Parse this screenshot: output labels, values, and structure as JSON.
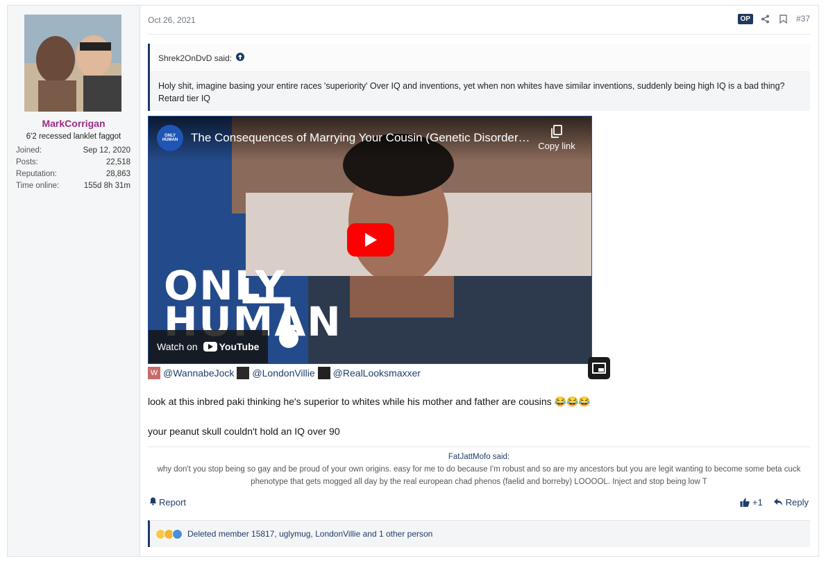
{
  "user": {
    "name": "MarkCorrigan",
    "title": "6'2 recessed lanklet faggot",
    "stats": [
      {
        "label": "Joined:",
        "value": "Sep 12, 2020"
      },
      {
        "label": "Posts:",
        "value": "22,518"
      },
      {
        "label": "Reputation:",
        "value": "28,863"
      },
      {
        "label": "Time online:",
        "value": "155d 8h 31m"
      }
    ]
  },
  "post": {
    "date": "Oct 26, 2021",
    "op_badge": "OP",
    "number": "#37",
    "quote": {
      "author": "Shrek2OnDvD said:",
      "text": "Holy shit, imagine basing your entire races 'superiority' Over IQ and inventions, yet when non whites have similar inventions, suddenly being high IQ is a bad thing? Retard tier IQ"
    },
    "video": {
      "channel_logo_text": "ONLY HUMAN",
      "title": "The Consequences of Marrying Your Cousin (Genetic Disorders Documentary)",
      "copy_link": "Copy link",
      "watch_on": "Watch on",
      "youtube": "YouTube",
      "overlay_text": "ONLY\nHUMAN"
    },
    "mentions": [
      {
        "name": "@WannabeJock",
        "avatar_letter": "W",
        "avatar_color": "#c96a6a"
      },
      {
        "name": "@LondonVillie",
        "avatar_letter": "",
        "avatar_color": "#2a2a2a"
      },
      {
        "name": "@RealLooksmaxxer",
        "avatar_letter": "",
        "avatar_color": "#222222"
      }
    ],
    "line1": "look at this inbred paki thinking he's superior to whites while his mother and father are cousins",
    "line2": "your peanut skull couldn't hold an IQ over 90",
    "signature": {
      "author": "FatJattMofo said:",
      "text": "why don't you stop being so gay and be proud of your own origins. easy for me to do because I'm robust and so are my ancestors but you are legit wanting to become some beta cuck phenotype that gets mogged all day by the real european chad phenos (faelid and borreby) LOOOOL. Inject and stop being low T"
    },
    "report": "Report",
    "like": "+1",
    "reply": "Reply",
    "reactions_text": "Deleted member 15817, uglymug, LondonVillie and 1 other person"
  },
  "colors": {
    "username": "#9b2c86",
    "link": "#1f3d6b",
    "accent": "#1b3a6b",
    "youtube_red": "#ff0000"
  }
}
